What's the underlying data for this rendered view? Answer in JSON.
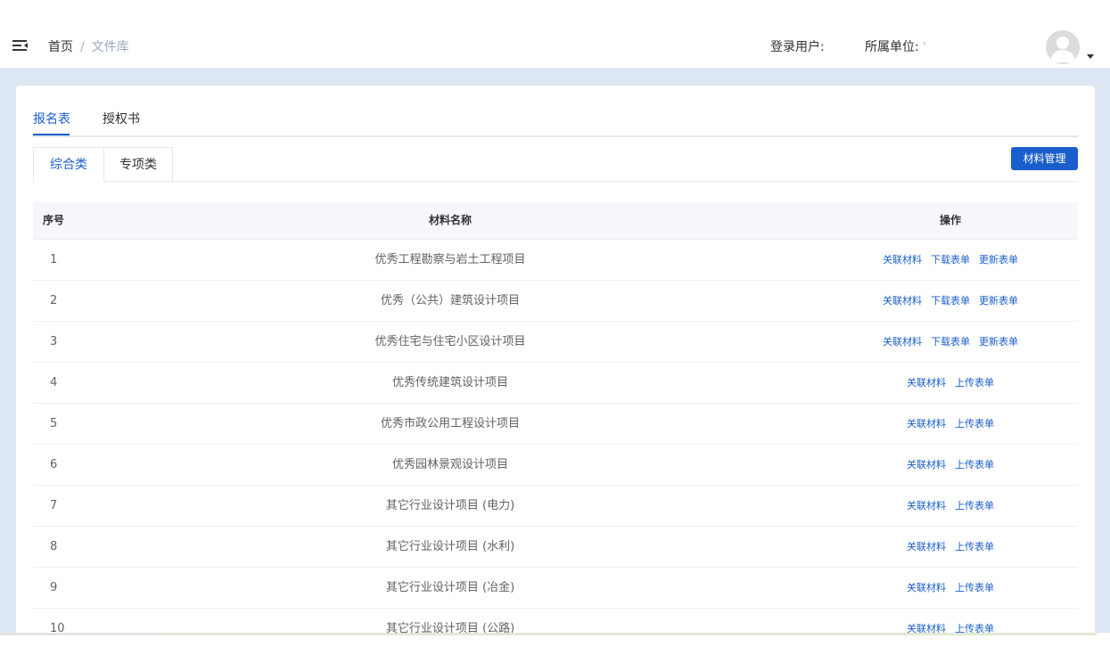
{
  "header": {
    "breadcrumb": {
      "home": "首页",
      "separator": "/",
      "current": "文件库"
    },
    "login_user_label": "登录用户:",
    "org_label": "所属单位:",
    "org_value": "'"
  },
  "top_tabs": [
    {
      "label": "报名表",
      "active": true
    },
    {
      "label": "授权书",
      "active": false
    }
  ],
  "sub_tabs": [
    {
      "label": "综合类",
      "active": true
    },
    {
      "label": "专项类",
      "active": false
    }
  ],
  "manage_button_label": "材料管理",
  "table": {
    "headers": {
      "index": "序号",
      "name": "材料名称",
      "ops": "操作"
    },
    "rows": [
      {
        "index": "1",
        "name": "优秀工程勘察与岩土工程项目",
        "ops": [
          "关联材料",
          "下载表单",
          "更新表单"
        ]
      },
      {
        "index": "2",
        "name": "优秀（公共）建筑设计项目",
        "ops": [
          "关联材料",
          "下载表单",
          "更新表单"
        ]
      },
      {
        "index": "3",
        "name": "优秀住宅与住宅小区设计项目",
        "ops": [
          "关联材料",
          "下载表单",
          "更新表单"
        ]
      },
      {
        "index": "4",
        "name": "优秀传统建筑设计项目",
        "ops": [
          "关联材料",
          "上传表单"
        ]
      },
      {
        "index": "5",
        "name": "优秀市政公用工程设计项目",
        "ops": [
          "关联材料",
          "上传表单"
        ]
      },
      {
        "index": "6",
        "name": "优秀园林景观设计项目",
        "ops": [
          "关联材料",
          "上传表单"
        ]
      },
      {
        "index": "7",
        "name": "其它行业设计项目 (电力)",
        "ops": [
          "关联材料",
          "上传表单"
        ]
      },
      {
        "index": "8",
        "name": "其它行业设计项目 (水利)",
        "ops": [
          "关联材料",
          "上传表单"
        ]
      },
      {
        "index": "9",
        "name": "其它行业设计项目 (冶金)",
        "ops": [
          "关联材料",
          "上传表单"
        ]
      },
      {
        "index": "10",
        "name": "其它行业设计项目 (公路)",
        "ops": [
          "关联材料",
          "上传表单"
        ]
      }
    ]
  },
  "colors": {
    "accent": "#1a5ecb",
    "page_bg": "#dde6f3",
    "header_bg": "#f5f7fa"
  },
  "icons": {
    "menu": "menu-fold-icon",
    "avatar": "user-avatar-icon",
    "caret": "caret-down-icon"
  }
}
